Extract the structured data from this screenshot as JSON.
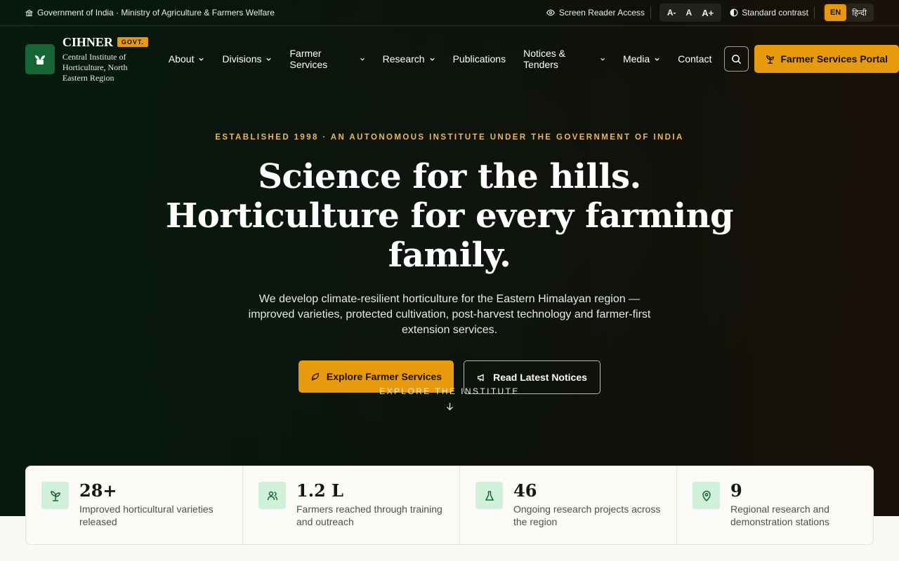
{
  "utility_bar": {
    "ministry": "Government of India · Ministry of Agriculture & Farmers Welfare",
    "screen_reader": "Screen Reader Access",
    "font_decrease": "A-",
    "font_default": "A",
    "font_increase": "A+",
    "contrast": "Standard contrast",
    "lang_en": "EN",
    "lang_hi": "हिन्दी"
  },
  "header": {
    "brand_name": "CIHNER",
    "badge": "GOVT.",
    "brand_sub": "Central Institute of Horticulture, North Eastern Region",
    "nav": [
      {
        "label": "About",
        "dropdown": true
      },
      {
        "label": "Divisions",
        "dropdown": true
      },
      {
        "label": "Farmer Services",
        "dropdown": true
      },
      {
        "label": "Research",
        "dropdown": true
      },
      {
        "label": "Publications",
        "dropdown": false
      },
      {
        "label": "Notices & Tenders",
        "dropdown": true
      },
      {
        "label": "Media",
        "dropdown": true
      },
      {
        "label": "Contact",
        "dropdown": false
      }
    ],
    "portal_button": "Farmer Services Portal"
  },
  "hero": {
    "eyebrow": "ESTABLISHED 1998 · AN AUTONOMOUS INSTITUTE UNDER THE GOVERNMENT OF INDIA",
    "headline": "Science for the hills. Horticulture for every farming family.",
    "subtext": "We develop climate-resilient horticulture for the Eastern Himalayan region — improved varieties, protected cultivation, post-harvest technology and farmer-first extension services.",
    "primary_cta": "Explore Farmer Services",
    "secondary_cta": "Read Latest Notices",
    "explore": "EXPLORE THE INSTITUTE"
  },
  "stats": [
    {
      "value": "28+",
      "label": "Improved horticultural varieties released",
      "icon": "sprout-icon"
    },
    {
      "value": "1.2 L",
      "label": "Farmers reached through training and outreach",
      "icon": "users-icon"
    },
    {
      "value": "46",
      "label": "Ongoing research projects across the region",
      "icon": "flask-icon"
    },
    {
      "value": "9",
      "label": "Regional research and demonstration stations",
      "icon": "map-pin-icon"
    }
  ],
  "colors": {
    "accent": "#e89a0e",
    "brand_green": "#166534",
    "stat_icon_bg": "#d1f0d9"
  }
}
